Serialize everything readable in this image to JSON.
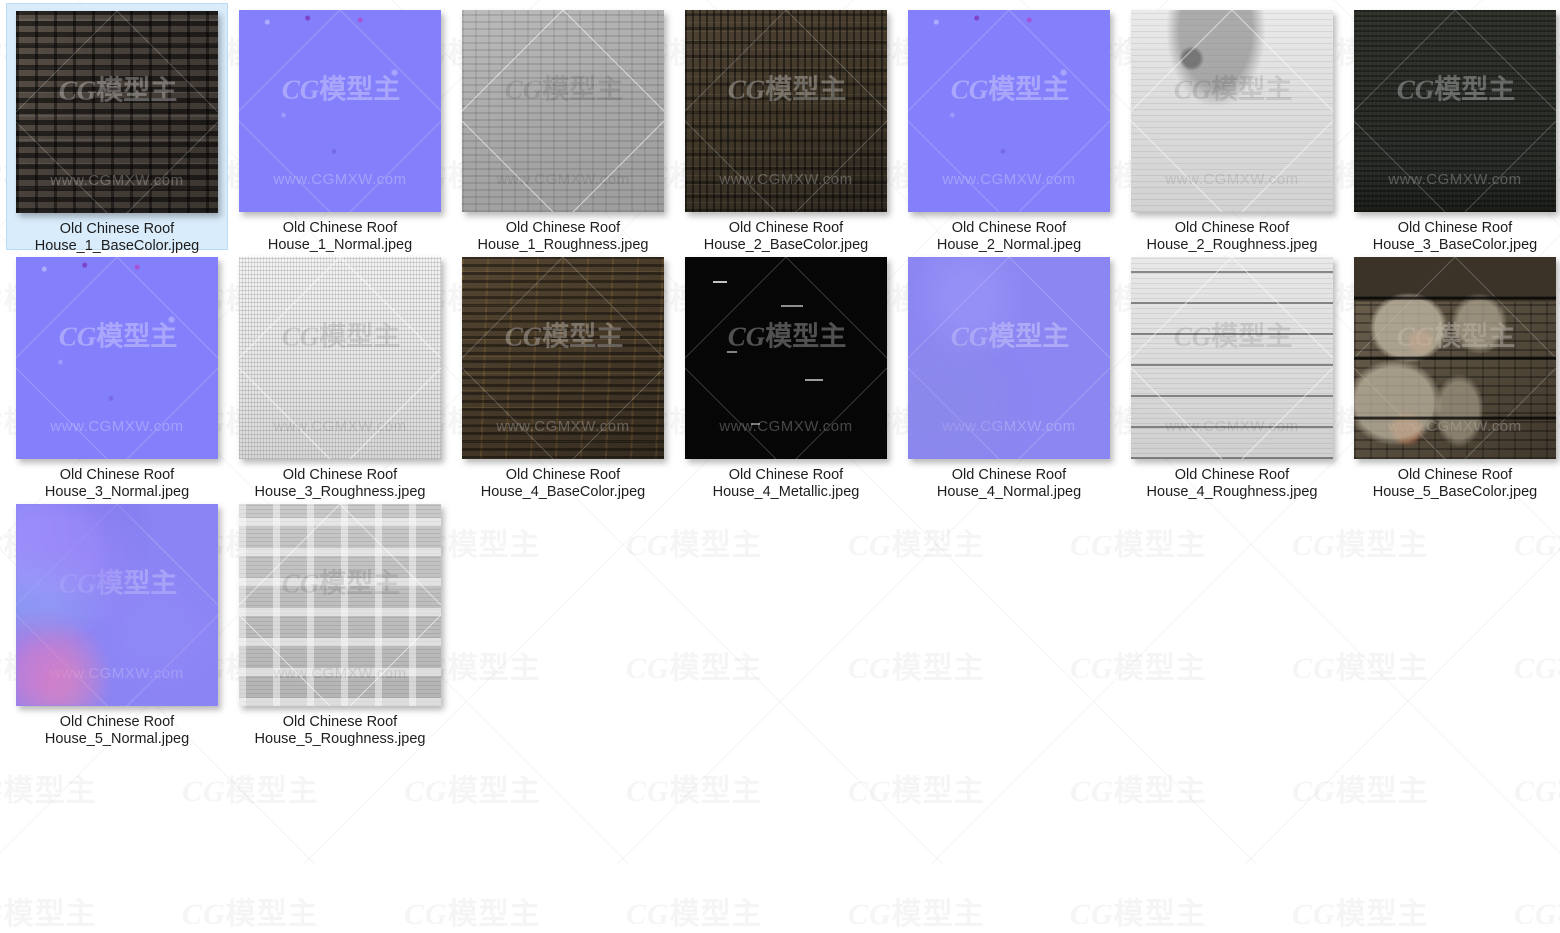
{
  "window": {
    "background_color": "#ffffff",
    "selection_color": "#d9ecfb",
    "layout": "icon-grid",
    "columns": 7,
    "rows": 3
  },
  "background_watermark": {
    "brand": "CG",
    "brand_cn": "模型主",
    "pattern": "diagonal-cross-hatch"
  },
  "thumbnail_watermark": {
    "brand": "CG",
    "brand_cn": "模型主",
    "url": "www.CGMXW.com"
  },
  "items": [
    {
      "line1": "Old Chinese Roof",
      "line2": "House_1_BaseColor.jpeg",
      "caption": "Old Chinese Roof\nHouse_1_BaseColor.jpeg",
      "texture": "t-basecolor-1",
      "tone": "dark",
      "selected": true
    },
    {
      "line1": "Old Chinese Roof",
      "line2": "House_1_Normal.jpeg",
      "caption": "Old Chinese Roof\nHouse_1_Normal.jpeg",
      "texture": "t-normal-flat",
      "tone": "dark",
      "selected": false
    },
    {
      "line1": "Old Chinese Roof",
      "line2": "House_1_Roughness.jpeg",
      "caption": "Old Chinese Roof\nHouse_1_Roughness.jpeg",
      "texture": "t-rough-1",
      "tone": "light",
      "selected": false
    },
    {
      "line1": "Old Chinese Roof",
      "line2": "House_2_BaseColor.jpeg",
      "caption": "Old Chinese Roof\nHouse_2_BaseColor.jpeg",
      "texture": "t-basecolor-2",
      "tone": "dark",
      "selected": false
    },
    {
      "line1": "Old Chinese Roof",
      "line2": "House_2_Normal.jpeg",
      "caption": "Old Chinese Roof\nHouse_2_Normal.jpeg",
      "texture": "t-normal-flat",
      "tone": "dark",
      "selected": false
    },
    {
      "line1": "Old Chinese Roof",
      "line2": "House_2_Roughness.jpeg",
      "caption": "Old Chinese Roof\nHouse_2_Roughness.jpeg",
      "texture": "t-rough-2",
      "tone": "light",
      "selected": false
    },
    {
      "line1": "Old Chinese Roof",
      "line2": "House_3_BaseColor.jpeg",
      "caption": "Old Chinese Roof\nHouse_3_BaseColor.jpeg",
      "texture": "t-basecolor-3",
      "tone": "dark",
      "selected": false
    },
    {
      "line1": "Old Chinese Roof",
      "line2": "House_3_Normal.jpeg",
      "caption": "Old Chinese Roof\nHouse_3_Normal.jpeg",
      "texture": "t-normal-flat",
      "tone": "dark",
      "selected": false
    },
    {
      "line1": "Old Chinese Roof",
      "line2": "House_3_Roughness.jpeg",
      "caption": "Old Chinese Roof\nHouse_3_Roughness.jpeg",
      "texture": "t-rough-3",
      "tone": "light",
      "selected": false
    },
    {
      "line1": "Old Chinese Roof",
      "line2": "House_4_BaseColor.jpeg",
      "caption": "Old Chinese Roof\nHouse_4_BaseColor.jpeg",
      "texture": "t-basecolor-4",
      "tone": "dark",
      "selected": false
    },
    {
      "line1": "Old Chinese Roof",
      "line2": "House_4_Metallic.jpeg",
      "caption": "Old Chinese Roof\nHouse_4_Metallic.jpeg",
      "texture": "t-metallic",
      "tone": "dark",
      "selected": false
    },
    {
      "line1": "Old Chinese Roof",
      "line2": "House_4_Normal.jpeg",
      "caption": "Old Chinese Roof\nHouse_4_Normal.jpeg",
      "texture": "t-normal-soft-b",
      "tone": "dark",
      "selected": false
    },
    {
      "line1": "Old Chinese Roof",
      "line2": "House_4_Roughness.jpeg",
      "caption": "Old Chinese Roof\nHouse_4_Roughness.jpeg",
      "texture": "t-rough-4",
      "tone": "light",
      "selected": false
    },
    {
      "line1": "Old Chinese Roof",
      "line2": "House_5_BaseColor.jpeg",
      "caption": "Old Chinese Roof\nHouse_5_BaseColor.jpeg",
      "texture": "t-basecolor-5",
      "tone": "dark",
      "selected": false
    },
    {
      "line1": "Old Chinese Roof",
      "line2": "House_5_Normal.jpeg",
      "caption": "Old Chinese Roof\nHouse_5_Normal.jpeg",
      "texture": "t-normal-soft",
      "tone": "dark",
      "selected": false
    },
    {
      "line1": "Old Chinese Roof",
      "line2": "House_5_Roughness.jpeg",
      "caption": "Old Chinese Roof\nHouse_5_Roughness.jpeg",
      "texture": "t-rough-5",
      "tone": "light",
      "selected": false
    }
  ]
}
